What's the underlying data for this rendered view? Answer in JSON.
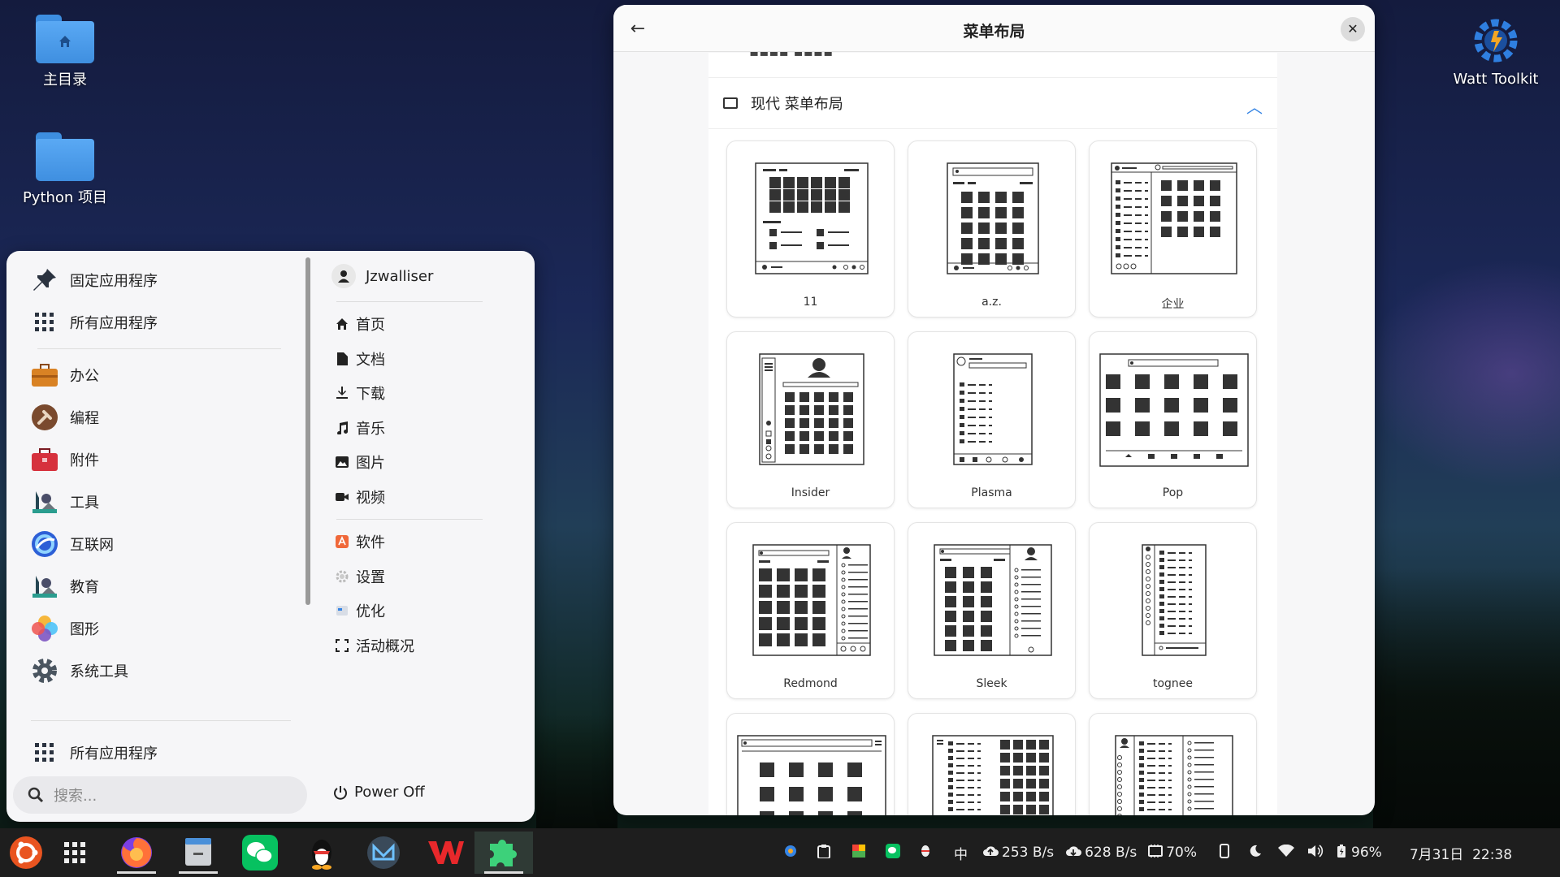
{
  "desktop": {
    "icons": [
      {
        "label": "主目录",
        "icon": "home-folder-icon"
      },
      {
        "label": "Python 项目",
        "icon": "folder-icon"
      }
    ],
    "watt_label": "Watt Toolkit"
  },
  "menu": {
    "categories": [
      {
        "label": "固定应用程序",
        "icon": "pin-icon"
      },
      {
        "label": "所有应用程序",
        "icon": "grid-icon"
      },
      {
        "label": "办公",
        "icon": "briefcase-icon"
      },
      {
        "label": "编程",
        "icon": "hammer-icon"
      },
      {
        "label": "附件",
        "icon": "toolbox-icon"
      },
      {
        "label": "工具",
        "icon": "tools-icon"
      },
      {
        "label": "互联网",
        "icon": "internet-icon"
      },
      {
        "label": "教育",
        "icon": "education-icon"
      },
      {
        "label": "图形",
        "icon": "graphics-icon"
      },
      {
        "label": "系统工具",
        "icon": "gear-icon"
      }
    ],
    "bottom_all_apps": "所有应用程序",
    "search_placeholder": "搜索...",
    "user_name": "Jzwalliser",
    "places": [
      {
        "label": "首页",
        "icon": "home-icon"
      },
      {
        "label": "文档",
        "icon": "document-icon"
      },
      {
        "label": "下载",
        "icon": "download-icon"
      },
      {
        "label": "音乐",
        "icon": "music-icon"
      },
      {
        "label": "图片",
        "icon": "image-icon"
      },
      {
        "label": "视频",
        "icon": "video-icon"
      }
    ],
    "system": [
      {
        "label": "软件",
        "icon": "software-icon"
      },
      {
        "label": "设置",
        "icon": "settings-icon"
      },
      {
        "label": "优化",
        "icon": "tweaks-icon"
      },
      {
        "label": "活动概况",
        "icon": "activities-icon"
      }
    ],
    "power_label": "Power Off"
  },
  "dialog": {
    "title": "菜单布局",
    "section_title": "现代 菜单布局",
    "layouts": [
      "11",
      "a.z.",
      "企业",
      "Insider",
      "Plasma",
      "Pop",
      "Redmond",
      "Sleek",
      "tognee",
      "",
      "",
      ""
    ]
  },
  "taskbar": {
    "net_up": "253 B/s",
    "net_down": "628 B/s",
    "ime": "中",
    "cpu": "70%",
    "battery": "96%",
    "datetime": "7月31日  22:38"
  }
}
